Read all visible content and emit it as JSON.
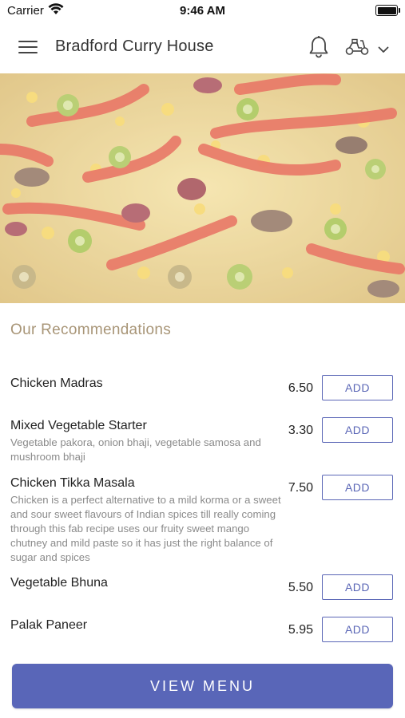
{
  "status_bar": {
    "carrier": "Carrier",
    "time": "9:46 AM"
  },
  "header": {
    "title": "Bradford Curry House",
    "icons": [
      "menu-icon",
      "bell-icon",
      "scooter-icon",
      "chevron-down-icon"
    ]
  },
  "hero": {
    "image": "pizza-image"
  },
  "recommendations": {
    "title": "Our Recommendations",
    "items": [
      {
        "name": "Chicken Madras",
        "description": "",
        "price": "6.50",
        "button": "ADD"
      },
      {
        "name": "Mixed Vegetable Starter",
        "description": "Vegetable pakora, onion bhaji, vegetable samosa and mushroom bhaji",
        "price": "3.30",
        "button": "ADD"
      },
      {
        "name": "Chicken Tikka Masala",
        "description": "Chicken is a perfect alternative to a mild korma or a sweet and sour sweet flavours of Indian spices till really coming through this fab recipe uses our fruity sweet mango chutney and mild paste so it has just the right balance of sugar and spices",
        "price": "7.50",
        "button": "ADD"
      },
      {
        "name": "Vegetable Bhuna",
        "description": "",
        "price": "5.50",
        "button": "ADD"
      },
      {
        "name": "Palak Paneer",
        "description": "",
        "price": "5.95",
        "button": "ADD"
      }
    ]
  },
  "footer": {
    "view_menu_label": "VIEW MENU"
  },
  "colors": {
    "accent": "#5966b8",
    "section_title": "#a89577"
  }
}
